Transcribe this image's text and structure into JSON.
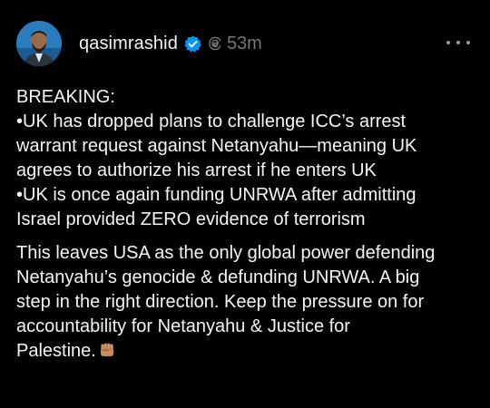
{
  "post": {
    "username": "qasimrashid",
    "timestamp": "53m",
    "icons": {
      "avatar": "profile-photo",
      "verified": "verified-badge-icon",
      "threads": "threads-logo-icon",
      "more": "more-horizontal-icon",
      "emoji": "raised-fist-emoji"
    },
    "colors": {
      "background": "#000000",
      "text": "#f3f5f7",
      "muted": "#777777",
      "verified_blue": "#0095f6"
    },
    "paragraphs": [
      {
        "lines": [
          "BREAKING:",
          "•UK has dropped plans to challenge ICC’s arrest",
          "warrant request against Netanyahu—meaning UK",
          "agrees to authorize his arrest if he enters UK",
          "•UK is once again funding UNRWA after admitting",
          "Israel provided ZERO evidence of terrorism"
        ]
      },
      {
        "lines": [
          "This leaves USA as the only global power defending",
          "Netanyahu’s genocide & defunding UNRWA. A big",
          "step in the right direction. Keep the pressure on for",
          "accountability for Netanyahu & Justice for",
          "Palestine."
        ]
      }
    ]
  }
}
